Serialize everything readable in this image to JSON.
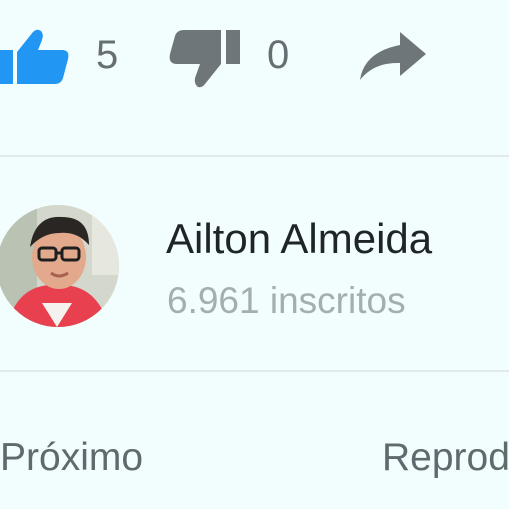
{
  "actions": {
    "likes": "5",
    "dislikes": "0",
    "like_color": "#2196f3",
    "neutral_icon_color": "#6e7679"
  },
  "channel": {
    "name": "Ailton Almeida",
    "subscribers": "6.961 inscritos",
    "avatar": "user-avatar-photo"
  },
  "footer": {
    "next_label": "Próximo",
    "autoplay_label": "Reprod"
  }
}
